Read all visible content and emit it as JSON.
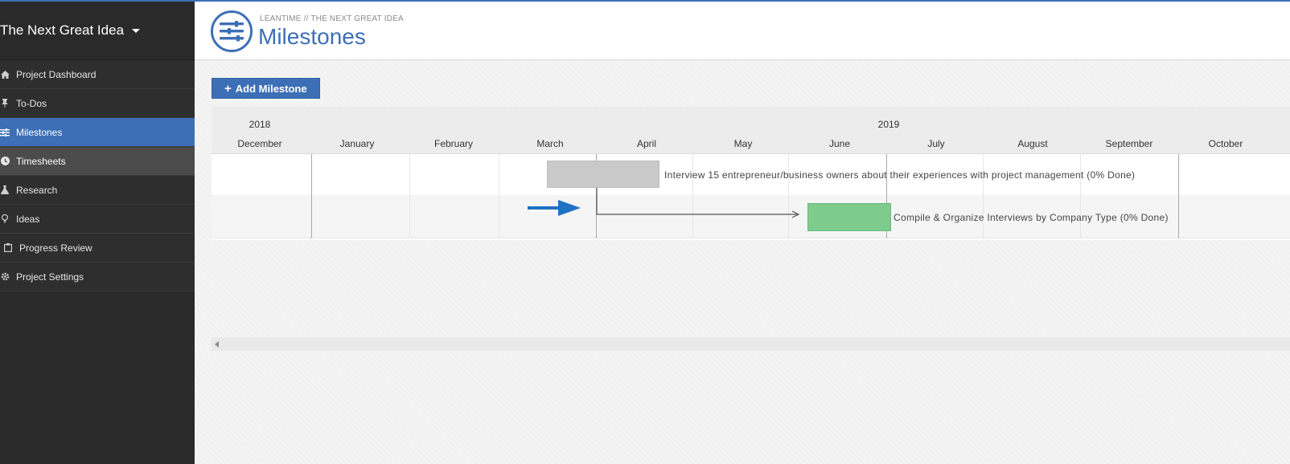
{
  "sidebar": {
    "project_name": "The Next Great Idea",
    "items": [
      {
        "label": "Project Dashboard",
        "icon": "home-icon"
      },
      {
        "label": "To-Dos",
        "icon": "thumbtack-icon"
      },
      {
        "label": "Milestones",
        "icon": "sliders-icon"
      },
      {
        "label": "Timesheets",
        "icon": "clock-icon"
      },
      {
        "label": "Research",
        "icon": "flask-icon"
      },
      {
        "label": "Ideas",
        "icon": "lightbulb-icon"
      },
      {
        "label": "Progress Review",
        "icon": "clipboard-icon"
      },
      {
        "label": "Project Settings",
        "icon": "gear-icon"
      }
    ]
  },
  "header": {
    "subtitle": "LEANTIME // THE NEXT GREAT IDEA",
    "title": "Milestones",
    "icon": "sliders-icon"
  },
  "toolbar": {
    "add_label": "Add Milestone"
  },
  "gantt": {
    "years": [
      "2018",
      "2019"
    ],
    "months": [
      "December",
      "January",
      "February",
      "March",
      "April",
      "May",
      "June",
      "July",
      "August",
      "September",
      "October"
    ],
    "tasks": [
      {
        "label": "Interview 15 entrepreneur/business owners about their experiences with project management (0% Done)",
        "color": "#c9c9c9",
        "progress": 0
      },
      {
        "label": "Compile & Organize Interviews by Company Type (0% Done)",
        "color": "#7ecb8e",
        "progress": 0
      }
    ]
  },
  "colors": {
    "accent": "#3d6fb6",
    "sidebar_bg": "#2a2a2a",
    "arrow": "#1f72c4"
  }
}
